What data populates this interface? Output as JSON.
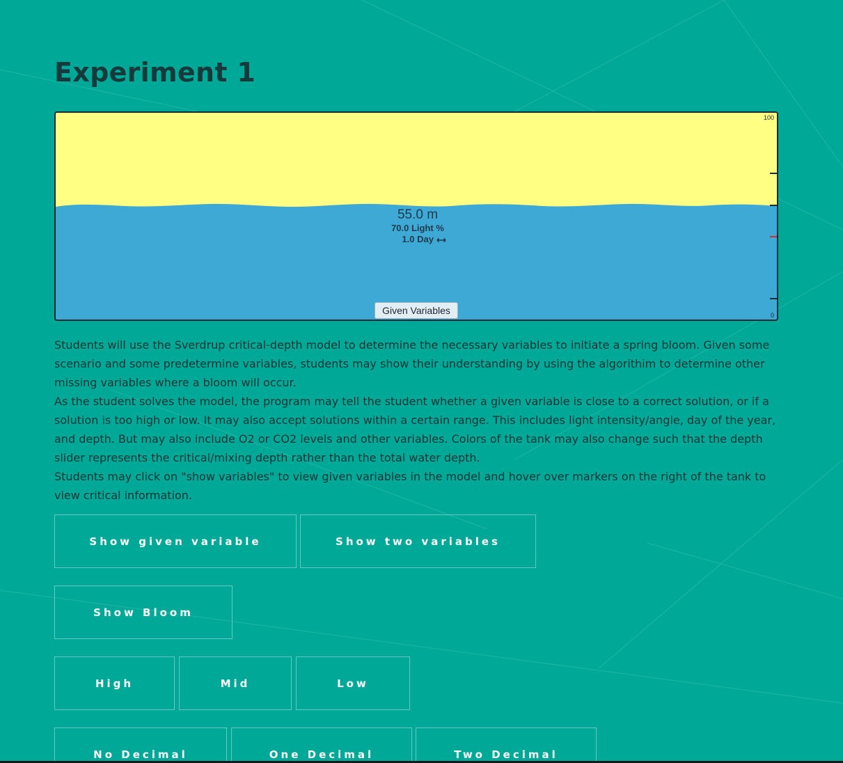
{
  "page": {
    "title": "Experiment 1"
  },
  "tank": {
    "depth_label": "55.0 m",
    "light_label": "70.0 Light %",
    "day_label": "1.0 Day",
    "day_icon": "arrows-horizontal-icon",
    "given_variables_button": "Given Variables",
    "scale_max": "100",
    "scale_min": "0",
    "surface_level_fraction": 0.45,
    "colors": {
      "sky": "#ffff84",
      "water": "#3fa9d5",
      "marker_red": "#d62b2b"
    }
  },
  "description": {
    "paragraph1": "Students will use the Sverdrup critical-depth model to determine the necessary variables to initiate a spring bloom. Given some scenario and some predetermine variables, students may show their understanding by using the algorithim to determine other missing variables where a bloom will occur.",
    "paragraph2": "As the student solves the model, the program may tell the student whether a given variable is close to a correct solution, or if a solution is too high or low. It may also accept solutions within a certain range. This includes light intensity/angle, day of the year, and depth. But may also include O2 or CO2 levels and other variables. Colors of the tank may also change such that the depth slider represents the critical/mixing depth rather than the total water depth.",
    "paragraph3": "Students may click on \"show variables\" to view given variables in the model and hover over markers on the right of the tank to view critical information."
  },
  "controls": {
    "show_given_variable": "Show given variable",
    "show_two_variables": "Show two variables",
    "show_bloom": "Show Bloom",
    "high": "High",
    "mid": "Mid",
    "low": "Low",
    "no_decimal": "No Decimal",
    "one_decimal": "One Decimal",
    "two_decimal": "Two Decimal"
  },
  "theme": {
    "background": "#00a997",
    "button_text": "#ffffff"
  }
}
